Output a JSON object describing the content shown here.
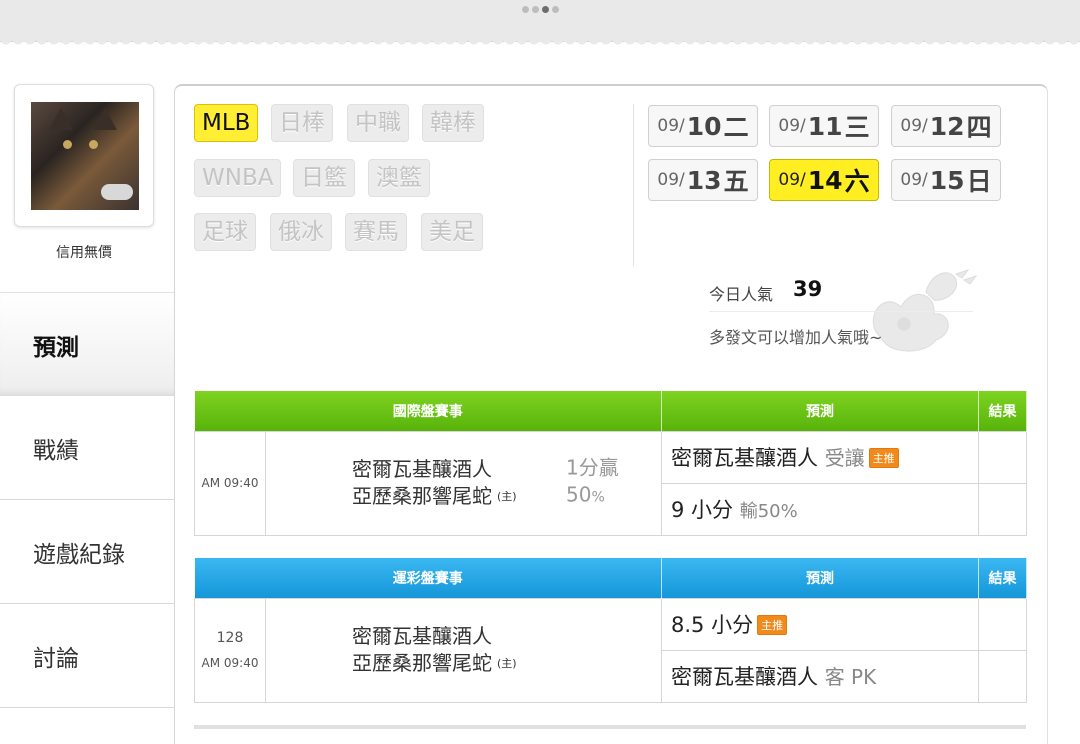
{
  "profile": {
    "name": "信用無價"
  },
  "sidebar": {
    "items": [
      {
        "label": "預測",
        "active": true
      },
      {
        "label": "戰績",
        "active": false
      },
      {
        "label": "遊戲紀錄",
        "active": false
      },
      {
        "label": "討論",
        "active": false
      }
    ]
  },
  "leagues": [
    {
      "label": "MLB",
      "active": true
    },
    {
      "label": "日棒",
      "active": false
    },
    {
      "label": "中職",
      "active": false
    },
    {
      "label": "韓棒",
      "active": false
    },
    {
      "label": "WNBA",
      "active": false
    },
    {
      "label": "日籃",
      "active": false
    },
    {
      "label": "澳籃",
      "active": false
    },
    {
      "label": "足球",
      "active": false
    },
    {
      "label": "俄冰",
      "active": false
    },
    {
      "label": "賽馬",
      "active": false
    },
    {
      "label": "美足",
      "active": false
    }
  ],
  "dates": [
    {
      "md": "09/",
      "day": "10",
      "wd": "二",
      "active": false
    },
    {
      "md": "09/",
      "day": "11",
      "wd": "三",
      "active": false
    },
    {
      "md": "09/",
      "day": "12",
      "wd": "四",
      "active": false
    },
    {
      "md": "09/",
      "day": "13",
      "wd": "五",
      "active": false
    },
    {
      "md": "09/",
      "day": "14",
      "wd": "六",
      "active": true
    },
    {
      "md": "09/",
      "day": "15",
      "wd": "日",
      "active": false
    }
  ],
  "popularity": {
    "label": "今日人氣",
    "value": "39",
    "note": "多發文可以增加人氣哦~"
  },
  "intl_table": {
    "headers": {
      "match": "國際盤賽事",
      "prediction": "預測",
      "result": "結果"
    },
    "time": "AM 09:40",
    "team_away": "密爾瓦基釀酒人",
    "team_home": "亞歷桑那響尾蛇",
    "host_mark": "(主)",
    "odds_line1": "1分贏",
    "odds_line2": "50",
    "odds_pct": "%",
    "pred1_main": "密爾瓦基釀酒人",
    "pred1_sub": "受讓",
    "pred1_badge": "主推",
    "pred2_main": "9 小分",
    "pred2_sub": "輸50%"
  },
  "sport_table": {
    "headers": {
      "match": "運彩盤賽事",
      "prediction": "預測",
      "result": "結果"
    },
    "game_no": "128",
    "time": "AM 09:40",
    "team_away": "密爾瓦基釀酒人",
    "team_home": "亞歷桑那響尾蛇",
    "host_mark": "(主)",
    "pred1_main": "8.5 小分",
    "pred1_badge": "主推",
    "pred2_main": "密爾瓦基釀酒人",
    "pred2_sub": "客 PK"
  }
}
